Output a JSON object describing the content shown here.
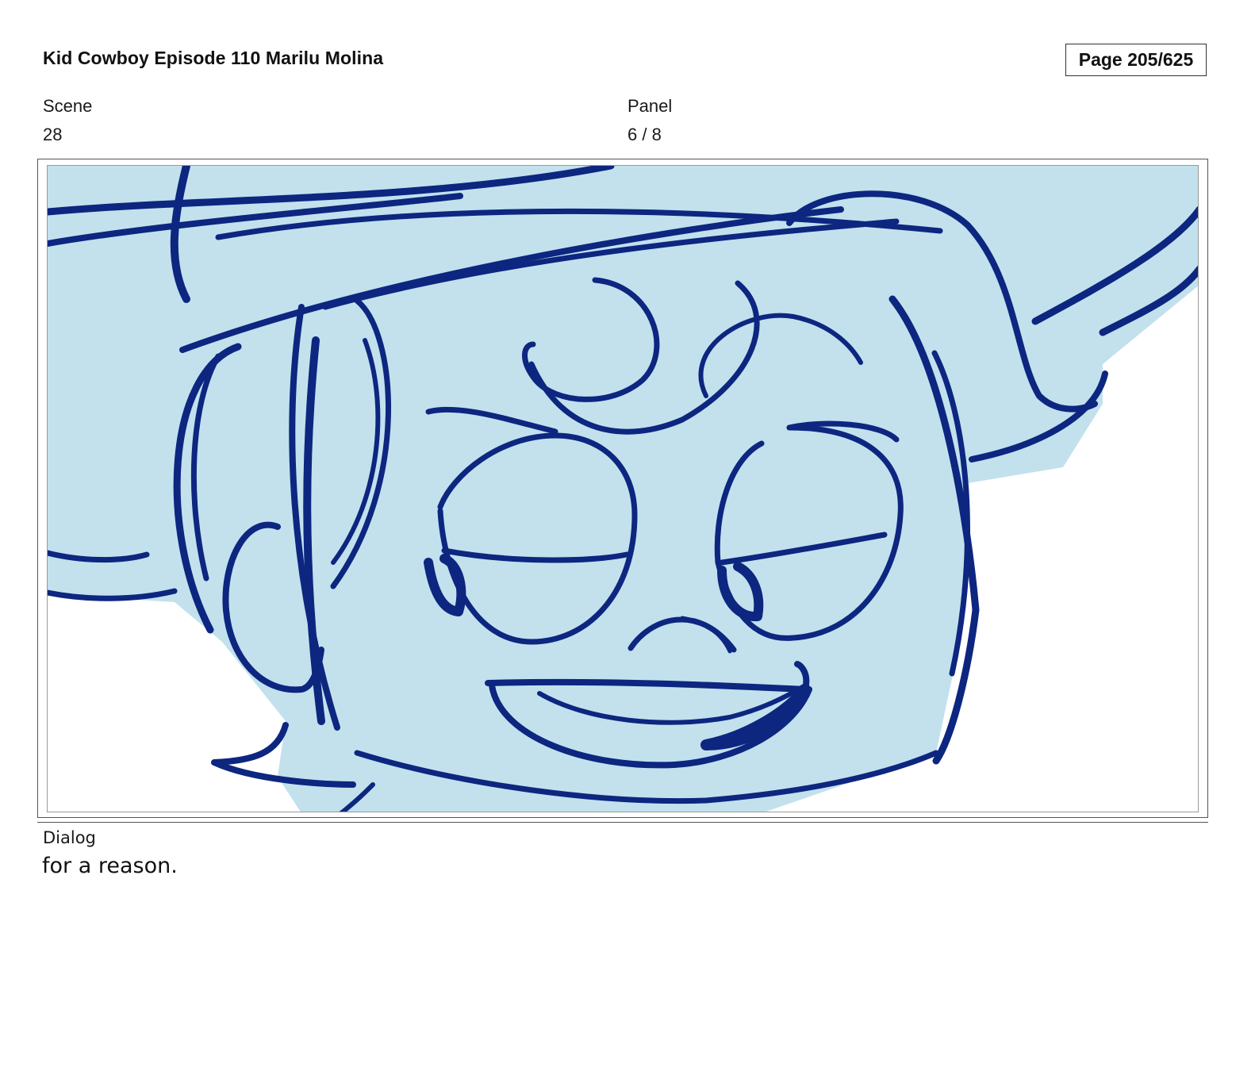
{
  "header": {
    "title": "Kid Cowboy Episode 110 Marilu Molina",
    "page": "Page 205/625"
  },
  "meta": {
    "scene_label": "Scene",
    "scene_value": "28",
    "panel_label": "Panel",
    "panel_value": "6 / 8"
  },
  "dialog": {
    "label": "Dialog",
    "text": "for a reason."
  },
  "colors": {
    "sketch_fill": "#c2e1ed",
    "sketch_line": "#0d2680",
    "panel_background": "#ffffff"
  }
}
